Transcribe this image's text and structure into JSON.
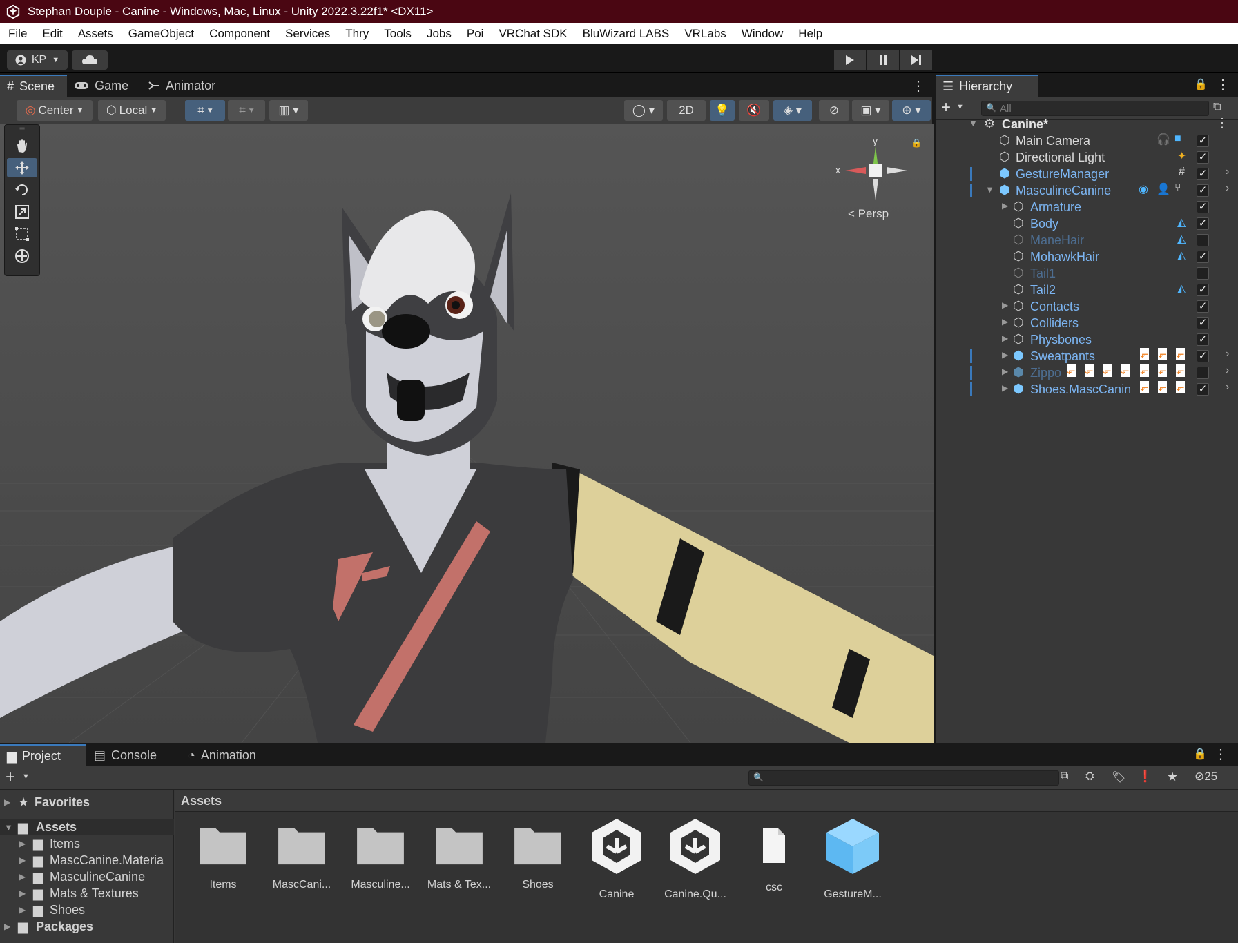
{
  "window": {
    "title": "Stephan Douple - Canine - Windows, Mac, Linux - Unity 2022.3.22f1* <DX11>"
  },
  "menu": [
    "File",
    "Edit",
    "Assets",
    "GameObject",
    "Component",
    "Services",
    "Thry",
    "Tools",
    "Jobs",
    "Poi",
    "VRChat SDK",
    "BluWizard LABS",
    "VRLabs",
    "Window",
    "Help"
  ],
  "toolbar": {
    "account": "KP"
  },
  "scene_tabs": [
    "Scene",
    "Game",
    "Animator"
  ],
  "scene_toolbar": {
    "pivot": "Center",
    "space": "Local",
    "mode2d": "2D"
  },
  "gizmo": {
    "y": "y",
    "x": "x",
    "projection": "< Persp"
  },
  "hierarchy": {
    "title": "Hierarchy",
    "search_placeholder": "All",
    "scene": "Canine*",
    "items": [
      {
        "name": "Main Camera",
        "checked": true
      },
      {
        "name": "Directional Light",
        "checked": true
      },
      {
        "name": "GestureManager",
        "checked": true
      },
      {
        "name": "MasculineCanine",
        "checked": true
      },
      {
        "name": "Armature",
        "checked": true
      },
      {
        "name": "Body",
        "checked": true
      },
      {
        "name": "ManeHair",
        "checked": false
      },
      {
        "name": "MohawkHair",
        "checked": true
      },
      {
        "name": "Tail1",
        "checked": false
      },
      {
        "name": "Tail2",
        "checked": true
      },
      {
        "name": "Contacts",
        "checked": true
      },
      {
        "name": "Colliders",
        "checked": true
      },
      {
        "name": "Physbones",
        "checked": true
      },
      {
        "name": "Sweatpants",
        "checked": true
      },
      {
        "name": "Zippo",
        "checked": false
      },
      {
        "name": "Shoes.MascCanin",
        "checked": true
      }
    ]
  },
  "bottom_tabs": [
    "Project",
    "Console",
    "Animation"
  ],
  "project": {
    "hidden_count": "25",
    "favorites": "Favorites",
    "assets_root": "Assets",
    "tree": [
      "Items",
      "MascCanine.Materia",
      "MasculineCanine",
      "Mats & Textures",
      "Shoes"
    ],
    "packages": "Packages",
    "breadcrumb": "Assets",
    "assets": [
      {
        "label": "Items",
        "icon": "folder-icon"
      },
      {
        "label": "MascCani...",
        "icon": "folder-icon"
      },
      {
        "label": "Masculine...",
        "icon": "folder-icon"
      },
      {
        "label": "Mats & Tex...",
        "icon": "folder-icon"
      },
      {
        "label": "Shoes",
        "icon": "folder-icon"
      },
      {
        "label": "Canine",
        "icon": "unity-scene-icon"
      },
      {
        "label": "Canine.Qu...",
        "icon": "unity-scene-icon"
      },
      {
        "label": "csc",
        "icon": "file-icon"
      },
      {
        "label": "GestureM...",
        "icon": "prefab-icon"
      }
    ]
  }
}
